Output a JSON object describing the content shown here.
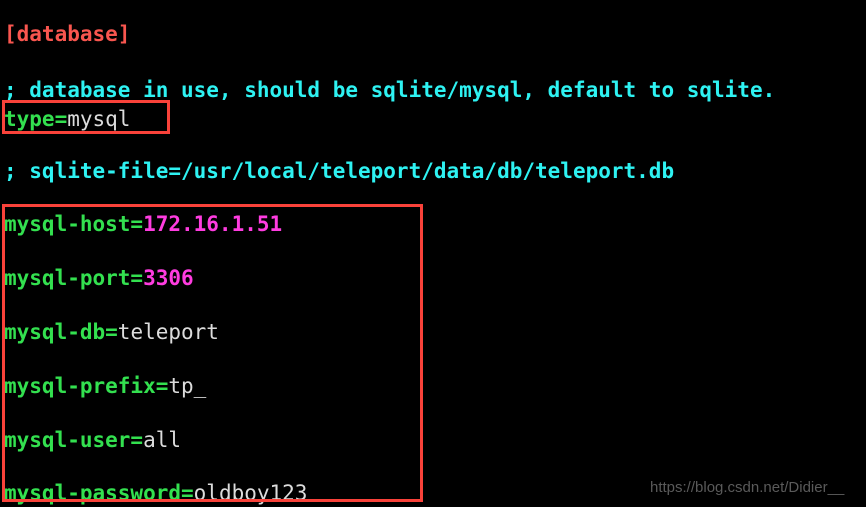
{
  "terminal": {
    "background_color": "#000000",
    "colors": {
      "section_header": "#f9564f",
      "comment": "#2ef2f2",
      "key": "#33e04f",
      "value_numeric": "#ff3ce0",
      "value_string": "#dcdcdc",
      "highlight_box": "#f9423a",
      "watermark": "#5a5a5a"
    },
    "lines": {
      "section_header": "[database]",
      "comment_type": "; database in use, should be sqlite/mysql, default to sqlite.",
      "comment_sqlite_file": "; sqlite-file=/usr/local/teleport/data/db/teleport.db"
    },
    "settings": {
      "type": {
        "key": "type=",
        "value": "mysql",
        "value_kind": "string"
      },
      "mysql_host": {
        "key": "mysql-host=",
        "value": "172.16.1.51",
        "value_kind": "numeric"
      },
      "mysql_port": {
        "key": "mysql-port=",
        "value": "3306",
        "value_kind": "numeric"
      },
      "mysql_db": {
        "key": "mysql-db=",
        "value": "teleport",
        "value_kind": "string"
      },
      "mysql_prefix": {
        "key": "mysql-prefix=",
        "value": "tp_",
        "value_kind": "string"
      },
      "mysql_user": {
        "key": "mysql-user=",
        "value": "all",
        "value_kind": "string"
      },
      "mysql_password": {
        "key": "mysql-password=",
        "value": "oldboy123",
        "value_kind": "string"
      }
    }
  },
  "watermark": {
    "text": "https://blog.csdn.net/Didier__"
  }
}
